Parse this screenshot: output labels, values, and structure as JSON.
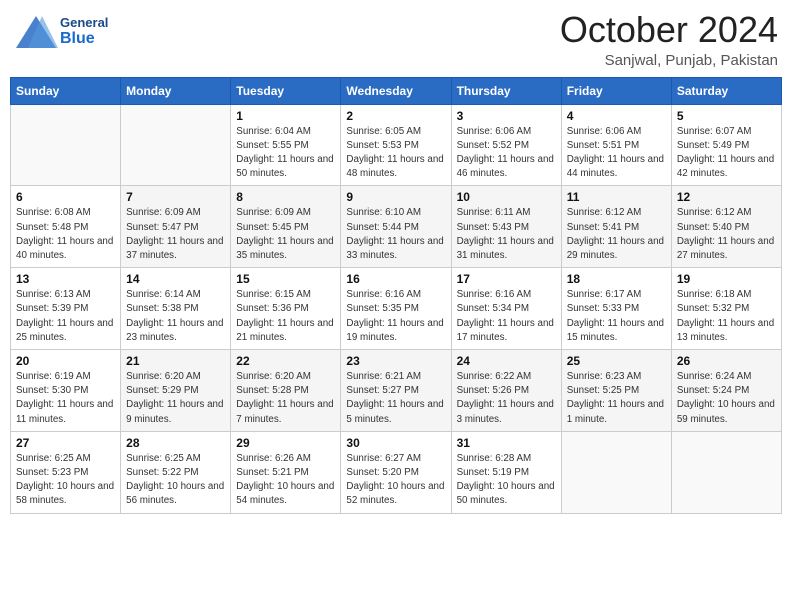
{
  "header": {
    "logo": {
      "line1": "General",
      "line2": "Blue"
    },
    "title": "October 2024",
    "subtitle": "Sanjwal, Punjab, Pakistan"
  },
  "weekdays": [
    "Sunday",
    "Monday",
    "Tuesday",
    "Wednesday",
    "Thursday",
    "Friday",
    "Saturday"
  ],
  "weeks": [
    {
      "days": [
        {
          "num": "",
          "info": ""
        },
        {
          "num": "",
          "info": ""
        },
        {
          "num": "1",
          "info": "Sunrise: 6:04 AM\nSunset: 5:55 PM\nDaylight: 11 hours and 50 minutes."
        },
        {
          "num": "2",
          "info": "Sunrise: 6:05 AM\nSunset: 5:53 PM\nDaylight: 11 hours and 48 minutes."
        },
        {
          "num": "3",
          "info": "Sunrise: 6:06 AM\nSunset: 5:52 PM\nDaylight: 11 hours and 46 minutes."
        },
        {
          "num": "4",
          "info": "Sunrise: 6:06 AM\nSunset: 5:51 PM\nDaylight: 11 hours and 44 minutes."
        },
        {
          "num": "5",
          "info": "Sunrise: 6:07 AM\nSunset: 5:49 PM\nDaylight: 11 hours and 42 minutes."
        }
      ]
    },
    {
      "days": [
        {
          "num": "6",
          "info": "Sunrise: 6:08 AM\nSunset: 5:48 PM\nDaylight: 11 hours and 40 minutes."
        },
        {
          "num": "7",
          "info": "Sunrise: 6:09 AM\nSunset: 5:47 PM\nDaylight: 11 hours and 37 minutes."
        },
        {
          "num": "8",
          "info": "Sunrise: 6:09 AM\nSunset: 5:45 PM\nDaylight: 11 hours and 35 minutes."
        },
        {
          "num": "9",
          "info": "Sunrise: 6:10 AM\nSunset: 5:44 PM\nDaylight: 11 hours and 33 minutes."
        },
        {
          "num": "10",
          "info": "Sunrise: 6:11 AM\nSunset: 5:43 PM\nDaylight: 11 hours and 31 minutes."
        },
        {
          "num": "11",
          "info": "Sunrise: 6:12 AM\nSunset: 5:41 PM\nDaylight: 11 hours and 29 minutes."
        },
        {
          "num": "12",
          "info": "Sunrise: 6:12 AM\nSunset: 5:40 PM\nDaylight: 11 hours and 27 minutes."
        }
      ]
    },
    {
      "days": [
        {
          "num": "13",
          "info": "Sunrise: 6:13 AM\nSunset: 5:39 PM\nDaylight: 11 hours and 25 minutes."
        },
        {
          "num": "14",
          "info": "Sunrise: 6:14 AM\nSunset: 5:38 PM\nDaylight: 11 hours and 23 minutes."
        },
        {
          "num": "15",
          "info": "Sunrise: 6:15 AM\nSunset: 5:36 PM\nDaylight: 11 hours and 21 minutes."
        },
        {
          "num": "16",
          "info": "Sunrise: 6:16 AM\nSunset: 5:35 PM\nDaylight: 11 hours and 19 minutes."
        },
        {
          "num": "17",
          "info": "Sunrise: 6:16 AM\nSunset: 5:34 PM\nDaylight: 11 hours and 17 minutes."
        },
        {
          "num": "18",
          "info": "Sunrise: 6:17 AM\nSunset: 5:33 PM\nDaylight: 11 hours and 15 minutes."
        },
        {
          "num": "19",
          "info": "Sunrise: 6:18 AM\nSunset: 5:32 PM\nDaylight: 11 hours and 13 minutes."
        }
      ]
    },
    {
      "days": [
        {
          "num": "20",
          "info": "Sunrise: 6:19 AM\nSunset: 5:30 PM\nDaylight: 11 hours and 11 minutes."
        },
        {
          "num": "21",
          "info": "Sunrise: 6:20 AM\nSunset: 5:29 PM\nDaylight: 11 hours and 9 minutes."
        },
        {
          "num": "22",
          "info": "Sunrise: 6:20 AM\nSunset: 5:28 PM\nDaylight: 11 hours and 7 minutes."
        },
        {
          "num": "23",
          "info": "Sunrise: 6:21 AM\nSunset: 5:27 PM\nDaylight: 11 hours and 5 minutes."
        },
        {
          "num": "24",
          "info": "Sunrise: 6:22 AM\nSunset: 5:26 PM\nDaylight: 11 hours and 3 minutes."
        },
        {
          "num": "25",
          "info": "Sunrise: 6:23 AM\nSunset: 5:25 PM\nDaylight: 11 hours and 1 minute."
        },
        {
          "num": "26",
          "info": "Sunrise: 6:24 AM\nSunset: 5:24 PM\nDaylight: 10 hours and 59 minutes."
        }
      ]
    },
    {
      "days": [
        {
          "num": "27",
          "info": "Sunrise: 6:25 AM\nSunset: 5:23 PM\nDaylight: 10 hours and 58 minutes."
        },
        {
          "num": "28",
          "info": "Sunrise: 6:25 AM\nSunset: 5:22 PM\nDaylight: 10 hours and 56 minutes."
        },
        {
          "num": "29",
          "info": "Sunrise: 6:26 AM\nSunset: 5:21 PM\nDaylight: 10 hours and 54 minutes."
        },
        {
          "num": "30",
          "info": "Sunrise: 6:27 AM\nSunset: 5:20 PM\nDaylight: 10 hours and 52 minutes."
        },
        {
          "num": "31",
          "info": "Sunrise: 6:28 AM\nSunset: 5:19 PM\nDaylight: 10 hours and 50 minutes."
        },
        {
          "num": "",
          "info": ""
        },
        {
          "num": "",
          "info": ""
        }
      ]
    }
  ]
}
